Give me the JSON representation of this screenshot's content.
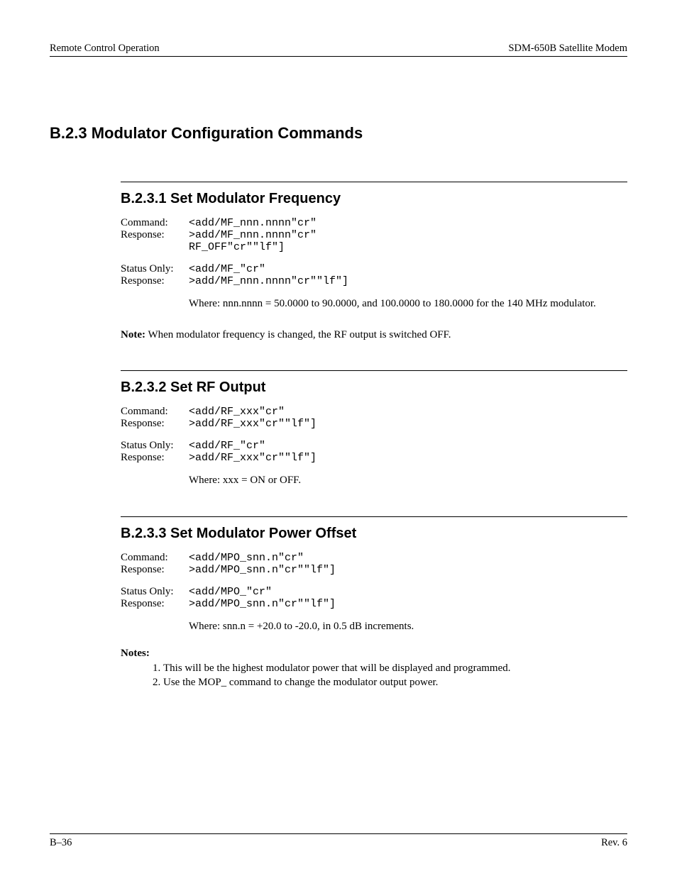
{
  "header": {
    "left": "Remote Control Operation",
    "right": "SDM-650B Satellite Modem"
  },
  "title": "B.2.3  Modulator Configuration Commands",
  "sections": [
    {
      "heading": "B.2.3.1  Set Modulator Frequency",
      "rows": [
        {
          "label": "Command:",
          "code": "<add/MF_nnn.nnnn\"cr\""
        },
        {
          "label": "Response:",
          "code": ">add/MF_nnn.nnnn\"cr\""
        },
        {
          "label": "",
          "code": "RF_OFF\"cr\"\"lf\"]"
        },
        {
          "spacer": true
        },
        {
          "label": "Status Only:",
          "code": "<add/MF_\"cr\""
        },
        {
          "label": "Response:",
          "code": ">add/MF_nnn.nnnn\"cr\"\"lf\"]"
        }
      ],
      "explain": "Where: nnn.nnnn = 50.0000 to 90.0000, and 100.0000 to 180.0000 for the 140 MHz modulator.",
      "note_bold": "Note:",
      "note_text": " When modulator frequency is changed, the RF output is switched OFF."
    },
    {
      "heading": "B.2.3.2  Set RF Output",
      "rows": [
        {
          "label": "Command:",
          "code": "<add/RF_xxx\"cr\""
        },
        {
          "label": "Response:",
          "code": ">add/RF_xxx\"cr\"\"lf\"]"
        },
        {
          "spacer": true
        },
        {
          "label": "Status Only:",
          "code": "<add/RF_\"cr\""
        },
        {
          "label": "Response:",
          "code": ">add/RF_xxx\"cr\"\"lf\"]"
        }
      ],
      "explain": "Where: xxx = ON or OFF."
    },
    {
      "heading": "B.2.3.3  Set Modulator Power Offset",
      "rows": [
        {
          "label": "Command:",
          "code": "<add/MPO_snn.n\"cr\""
        },
        {
          "label": "Response:",
          "code": ">add/MPO_snn.n\"cr\"\"lf\"]"
        },
        {
          "spacer": true
        },
        {
          "label": "Status Only:",
          "code": "<add/MPO_\"cr\""
        },
        {
          "label": "Response:",
          "code": ">add/MPO_snn.n\"cr\"\"lf\"]"
        }
      ],
      "explain": "Where: snn.n = +20.0 to -20.0, in 0.5 dB increments.",
      "notes_label": "Notes:",
      "notes_items": [
        "This will be the highest modulator power that will be displayed and programmed.",
        "Use the MOP_ command to change the modulator output power."
      ]
    }
  ],
  "footer": {
    "left": "B–36",
    "right": "Rev. 6"
  }
}
